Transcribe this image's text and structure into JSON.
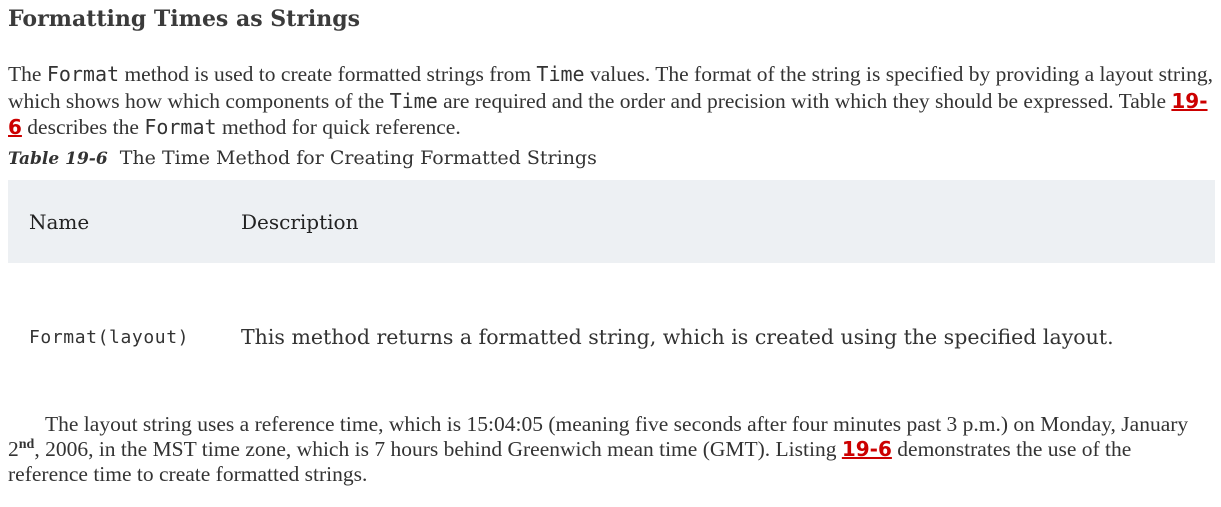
{
  "heading": "Formatting Times as Strings",
  "para1": {
    "t1": "The ",
    "code1": "Format",
    "t2": " method is used to create formatted strings from ",
    "code2": "Time",
    "t3": " values. The format of the string is specified by providing a layout string, which shows how which components of the ",
    "code3": "Time",
    "t4": " are required and the order and precision with which they should be expressed. Table ",
    "link": "19-6",
    "t5": " describes the ",
    "code4": "Format",
    "t6": " method for quick reference."
  },
  "caption": {
    "label": "Table 19-6",
    "text": "The Time Method for Creating Formatted Strings"
  },
  "table": {
    "headers": {
      "name": "Name",
      "description": "Description"
    },
    "rows": [
      {
        "name": "Format(layout)",
        "description": "This method returns a formatted string, which is created using the specified layout."
      }
    ]
  },
  "para2": {
    "t1": "The layout string uses a reference time, which is 15:04:05 (meaning five seconds after four minutes past 3 p.m.) on Monday, January 2",
    "sup": "nd",
    "t2": ", 2006, in the MST time zone, which is 7 hours behind Greenwich mean time (GMT). Listing ",
    "link": "19-6",
    "t3": " demonstrates the use of the reference time to create formatted strings."
  }
}
